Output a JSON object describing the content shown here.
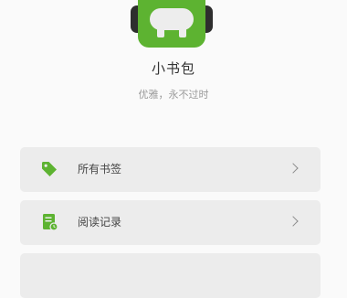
{
  "app": {
    "name": "小书包",
    "slogan": "优雅，永不过时",
    "logo_icon": "backpack-icon",
    "accent_color": "#5db331"
  },
  "menu": {
    "items": [
      {
        "label": "所有书签",
        "icon": "tag-icon"
      },
      {
        "label": "阅读记录",
        "icon": "history-document-icon"
      },
      {
        "label": "",
        "icon": ""
      }
    ]
  }
}
